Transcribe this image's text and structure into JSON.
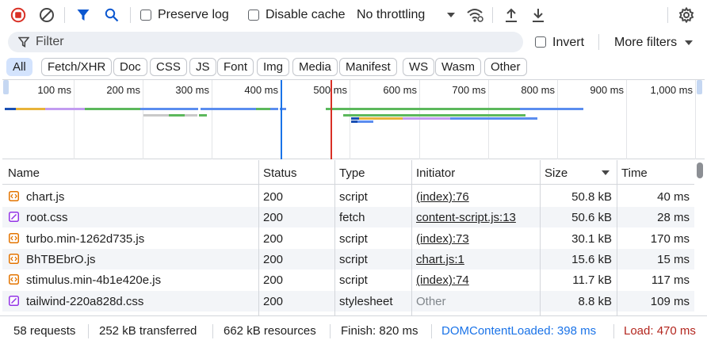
{
  "toolbar": {
    "record_icon": "record-stop-icon",
    "clear_icon": "clear-icon",
    "filter_icon": "filter-funnel-icon",
    "search_icon": "search-icon",
    "preserve_log_label": "Preserve log",
    "preserve_log_checked": false,
    "disable_cache_label": "Disable cache",
    "disable_cache_checked": false,
    "throttling_value": "No throttling",
    "network_conditions_icon": "wifi-settings-icon",
    "import_icon": "upload-icon",
    "export_icon": "download-icon",
    "settings_icon": "gear-icon",
    "colors": {
      "record": "#d93025",
      "accent": "#0b57d0"
    }
  },
  "filter": {
    "placeholder": "Filter",
    "value": "",
    "invert_label": "Invert",
    "invert_checked": false,
    "more_filters_label": "More filters"
  },
  "type_filters": [
    "All",
    "Fetch/XHR",
    "Doc",
    "CSS",
    "JS",
    "Font",
    "Img",
    "Media",
    "Manifest",
    "WS",
    "Wasm",
    "Other"
  ],
  "type_filters_selected": "All",
  "overview": {
    "ticks": [
      "100 ms",
      "200 ms",
      "300 ms",
      "400 ms",
      "500 ms",
      "600 ms",
      "700 ms",
      "800 ms",
      "900 ms",
      "1,000 ms"
    ],
    "dom_content_loaded_color": "#1a73e8",
    "load_color": "#d93025"
  },
  "table": {
    "columns": {
      "name": "Name",
      "status": "Status",
      "type": "Type",
      "initiator": "Initiator",
      "size": "Size",
      "time": "Time"
    },
    "sort_column": "Size",
    "sort_direction": "descending",
    "rows": [
      {
        "name": "chart.js",
        "kind": "script",
        "status": "200",
        "type": "script",
        "initiator": "(index):76",
        "initiator_is_link": true,
        "size": "50.8 kB",
        "time": "40 ms"
      },
      {
        "name": "root.css",
        "kind": "fetch",
        "status": "200",
        "type": "fetch",
        "initiator": "content-script.js:13",
        "initiator_is_link": true,
        "size": "50.6 kB",
        "time": "28 ms"
      },
      {
        "name": "turbo.min-1262d735.js",
        "kind": "script",
        "status": "200",
        "type": "script",
        "initiator": "(index):73",
        "initiator_is_link": true,
        "size": "30.1 kB",
        "time": "170 ms"
      },
      {
        "name": "BhTBEbrO.js",
        "kind": "script",
        "status": "200",
        "type": "script",
        "initiator": "chart.js:1",
        "initiator_is_link": true,
        "size": "15.6 kB",
        "time": "15 ms"
      },
      {
        "name": "stimulus.min-4b1e420e.js",
        "kind": "script",
        "status": "200",
        "type": "script",
        "initiator": "(index):74",
        "initiator_is_link": true,
        "size": "11.7 kB",
        "time": "117 ms"
      },
      {
        "name": "tailwind-220a828d.css",
        "kind": "stylesheet",
        "status": "200",
        "type": "stylesheet",
        "initiator": "Other",
        "initiator_is_link": false,
        "size": "8.8 kB",
        "time": "109 ms"
      }
    ]
  },
  "summary": {
    "requests": "58 requests",
    "transferred": "252 kB transferred",
    "resources": "662 kB resources",
    "finish": "Finish: 820 ms",
    "dom_content_loaded": "DOMContentLoaded: 398 ms",
    "load": "Load: 470 ms",
    "colors": {
      "dom_content_loaded": "#1a73e8",
      "load": "#b3261e"
    }
  }
}
